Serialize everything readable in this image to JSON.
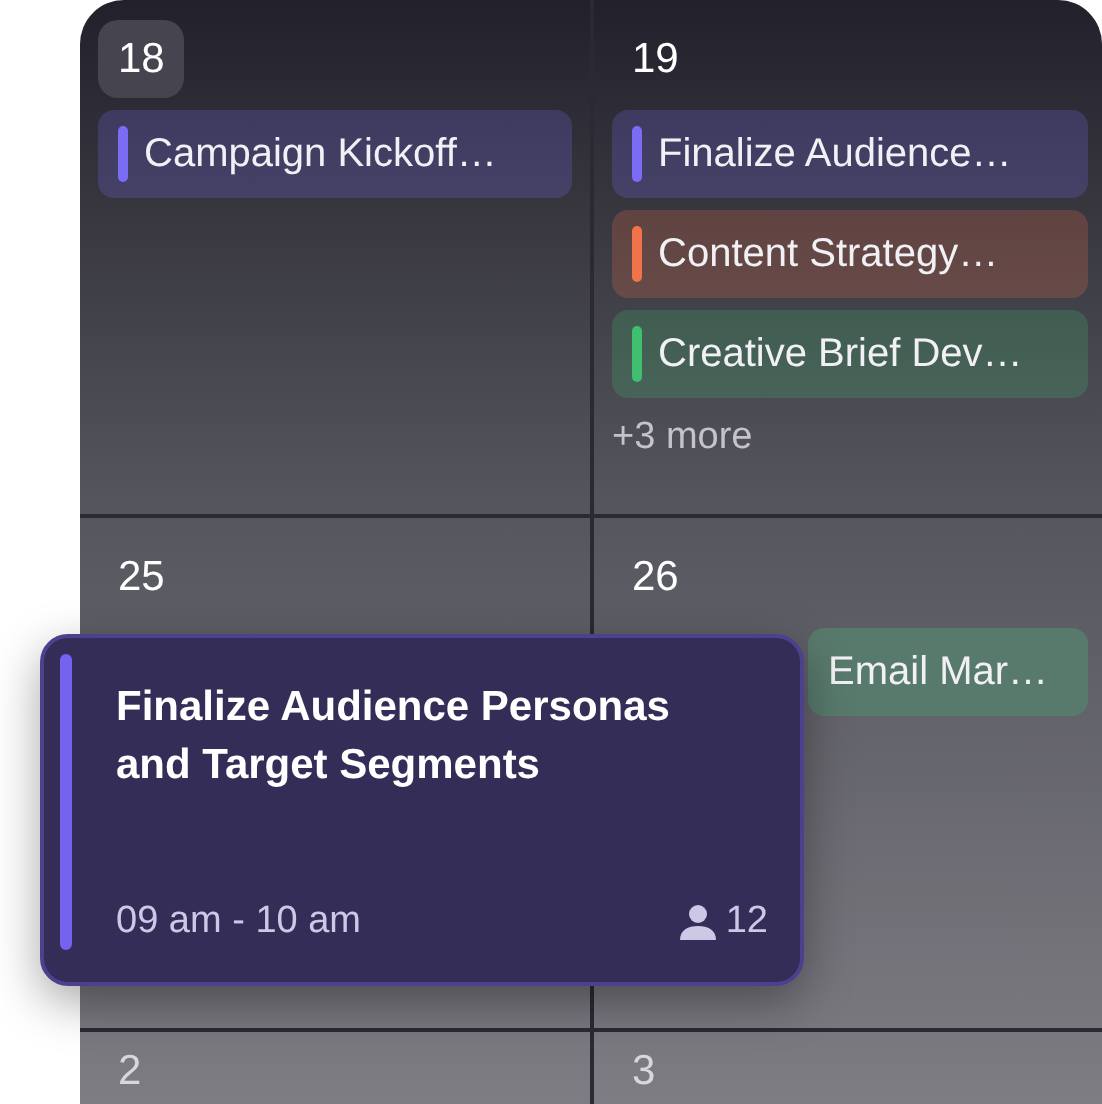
{
  "days": [
    {
      "date": "18",
      "selected": true,
      "events": [
        {
          "title": "Campaign Kickoff…",
          "color": "#7b6cf6"
        }
      ]
    },
    {
      "date": "19",
      "selected": false,
      "events": [
        {
          "title": "Finalize Audience…",
          "color": "#7b6cf6"
        },
        {
          "title": "Content Strategy…",
          "color": "#f0734a"
        },
        {
          "title": "Creative Brief Dev…",
          "color": "#3fbf6f"
        }
      ],
      "more": "+3 more"
    },
    {
      "date": "25",
      "selected": false
    },
    {
      "date": "26",
      "selected": false,
      "events": [
        {
          "title": "Email Mar…",
          "color": "#587a6c",
          "kind": "plain"
        }
      ]
    },
    {
      "date": "2",
      "selected": false
    },
    {
      "date": "3",
      "selected": false
    }
  ],
  "popover": {
    "title": "Finalize Audience Personas and Target Segments",
    "time": "09 am - 10 am",
    "attendees": "12",
    "color": "#7563f0"
  }
}
